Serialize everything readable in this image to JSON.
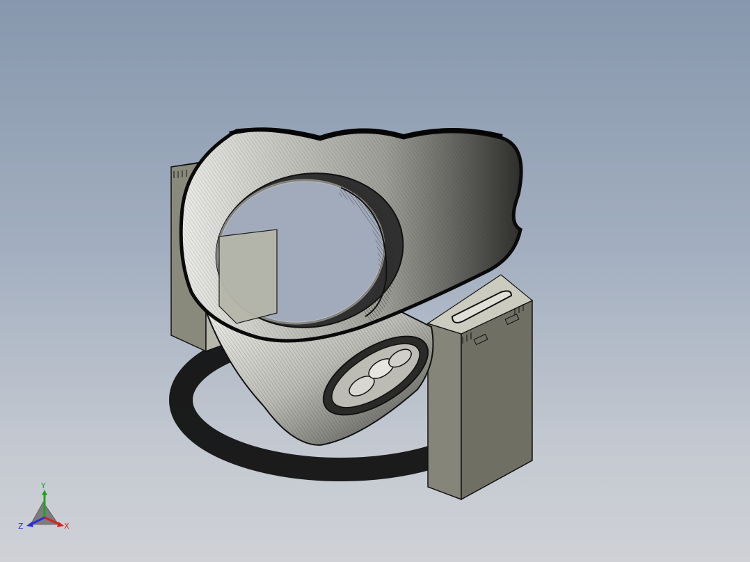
{
  "view": {
    "background_top": "#8797ad",
    "background_bottom": "#cfd1d6",
    "model_fill": "#d8d8d0",
    "model_edge": "#111111",
    "support_fill": "#7e7e70",
    "support_side": "#9a9a8c",
    "shadow": "#0a0a0a"
  },
  "triad": {
    "x_label": "X",
    "y_label": "Y",
    "z_label": "Z",
    "x_color": "#d42020",
    "y_color": "#1fa31f",
    "z_color": "#2b2be0",
    "icon": "axis-triad-icon"
  }
}
